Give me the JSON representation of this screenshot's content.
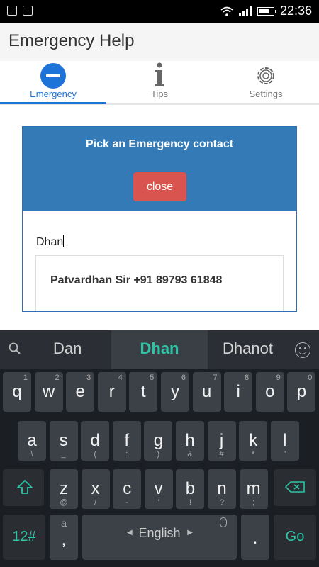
{
  "statusbar": {
    "time": "22:36"
  },
  "app": {
    "title": "Emergency Help"
  },
  "tabs": [
    {
      "label": "Emergency",
      "icon": "minus-circle-icon",
      "active": true
    },
    {
      "label": "Tips",
      "icon": "info-icon",
      "active": false
    },
    {
      "label": "Settings",
      "icon": "gear-icon",
      "active": false
    }
  ],
  "dialog": {
    "title": "Pick an Emergency contact",
    "close_label": "close",
    "search_value": "Dhan",
    "results": [
      {
        "text": "Patvardhan Sir +91 89793 61848"
      }
    ]
  },
  "keyboard": {
    "suggestions": [
      "Dan",
      "Dhan",
      "Dhanot"
    ],
    "row1": [
      {
        "k": "q",
        "h": "1"
      },
      {
        "k": "w",
        "h": "2"
      },
      {
        "k": "e",
        "h": "3"
      },
      {
        "k": "r",
        "h": "4"
      },
      {
        "k": "t",
        "h": "5"
      },
      {
        "k": "y",
        "h": "6"
      },
      {
        "k": "u",
        "h": "7"
      },
      {
        "k": "i",
        "h": "8"
      },
      {
        "k": "o",
        "h": "9"
      },
      {
        "k": "p",
        "h": "0"
      }
    ],
    "row2": [
      {
        "k": "a",
        "h": "\\"
      },
      {
        "k": "s",
        "h": "_"
      },
      {
        "k": "d",
        "h": "("
      },
      {
        "k": "f",
        "h": ":"
      },
      {
        "k": "g",
        "h": ")"
      },
      {
        "k": "h",
        "h": "&"
      },
      {
        "k": "j",
        "h": "#"
      },
      {
        "k": "k",
        "h": "*"
      },
      {
        "k": "l",
        "h": "\""
      }
    ],
    "row3": [
      {
        "k": "z",
        "h": "@"
      },
      {
        "k": "x",
        "h": "/"
      },
      {
        "k": "c",
        "h": "-"
      },
      {
        "k": "v",
        "h": "'"
      },
      {
        "k": "b",
        "h": "!"
      },
      {
        "k": "n",
        "h": "?"
      },
      {
        "k": "m",
        "h": ";"
      }
    ],
    "num_label": "12#",
    "comma_label": ",",
    "comma_hint": "a",
    "space_label": "English",
    "period_label": ".",
    "go_label": "Go",
    "accent_color": "#2ec4a6"
  }
}
